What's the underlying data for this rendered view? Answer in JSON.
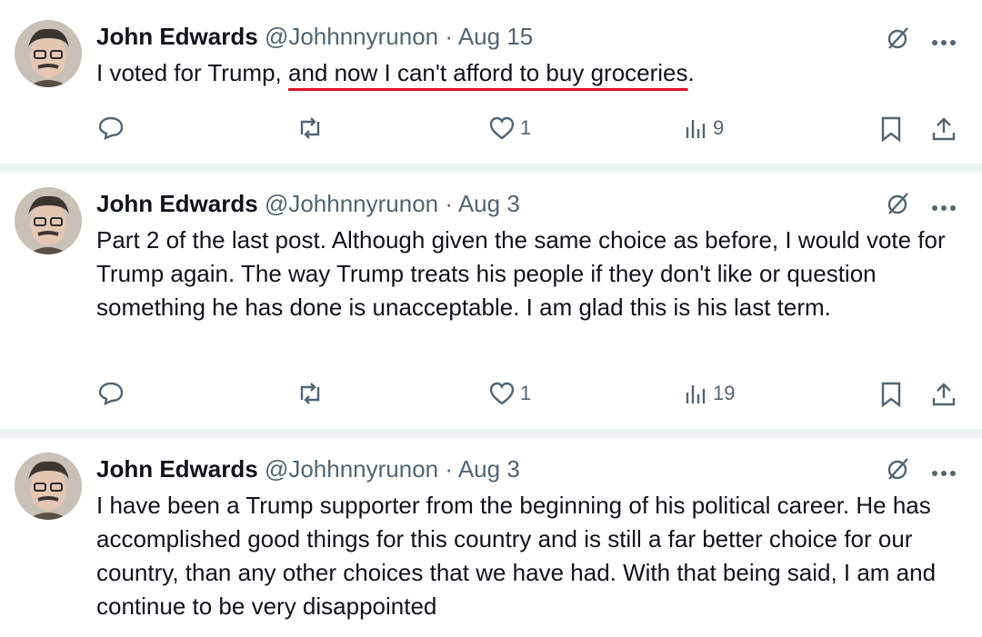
{
  "tweets": [
    {
      "author_name": "John Edwards",
      "handle": "@Johhnnyrunon",
      "separator": "·",
      "date": "Aug 15",
      "text_part1": "I voted for Trump, ",
      "text_highlight": "and now I can't afford to buy groceries",
      "text_part2": ".",
      "likes": "1",
      "views": "9"
    },
    {
      "author_name": "John Edwards",
      "handle": "@Johhnnyrunon",
      "separator": "·",
      "date": "Aug 3",
      "text": "Part 2 of the last post.  Although given the same choice as before, I would vote for Trump again.  The way Trump treats his people if they don't like or question something he has done is unacceptable.  I am glad this is his last term.",
      "likes": "1",
      "views": "19"
    },
    {
      "author_name": "John Edwards",
      "handle": "@Johhnnyrunon",
      "separator": "·",
      "date": "Aug 3",
      "text": "I have been a Trump supporter from the beginning of his political career.  He has accomplished good things for this country and is still a far better choice for our country, than any other choices that we have had.  With that being said, I am and continue to be very disappointed"
    }
  ],
  "icons": {
    "reply": "reply-icon",
    "repost": "repost-icon",
    "like": "heart-icon",
    "views": "views-icon",
    "bookmark": "bookmark-icon",
    "share": "share-icon",
    "grok": "grok-icon",
    "more": "more-icon"
  },
  "colors": {
    "text": "#0f1419",
    "muted": "#536471",
    "divider": "#eff3f4",
    "highlight_underline": "#e0102a"
  }
}
